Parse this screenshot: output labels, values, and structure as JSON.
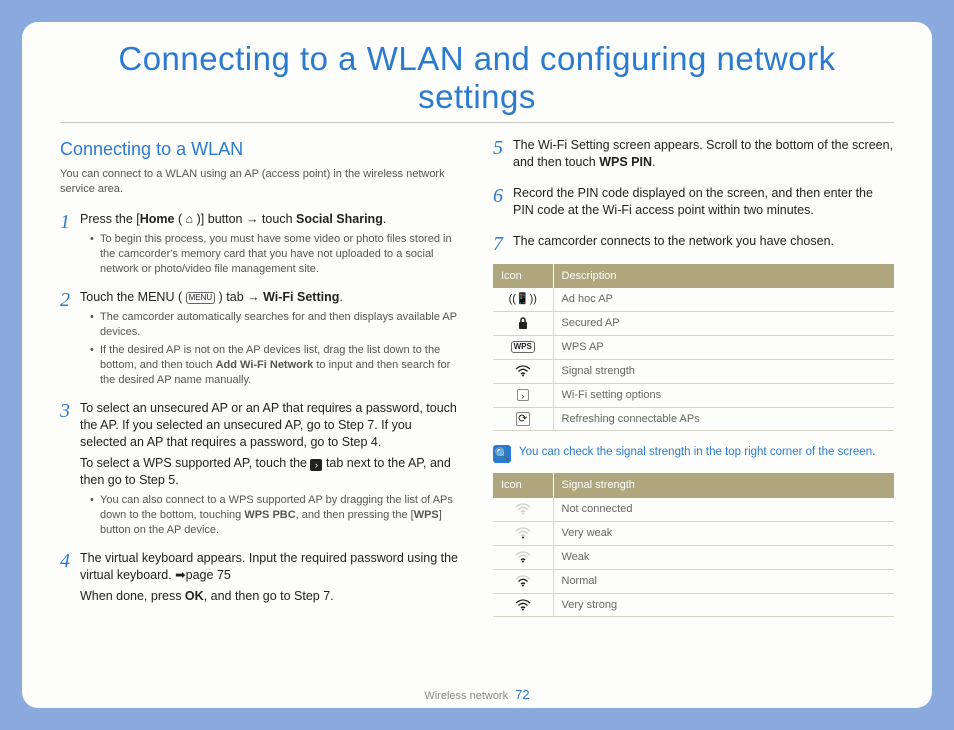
{
  "title": "Connecting to a WLAN and configuring network settings",
  "section": {
    "heading": "Connecting to a WLAN",
    "intro": "You can connect to a WLAN using an AP (access point) in the wireless network service area."
  },
  "steps": {
    "s1": {
      "pre": "Press the [",
      "home": "Home",
      "post": " )] button → touch ",
      "social": "Social Sharing",
      "end": ".",
      "b1": "To begin this process, you must have some video or photo files stored in the camcorder's memory card that you have not uploaded to a social network or photo/video file management site."
    },
    "s2": {
      "pre": "Touch the MENU ( ",
      "tab": " ) tab → ",
      "wifi": "Wi-Fi Setting",
      "end": ".",
      "b1": "The camcorder automatically searches for and then displays available AP devices.",
      "b2a": "If the desired AP is not on the AP devices list, drag the list down to the bottom, and then touch ",
      "b2b": "Add Wi-Fi Network",
      "b2c": " to input and then search for the desired AP name manually."
    },
    "s3": {
      "p1": "To select an unsecured AP or an AP that requires a password, touch the AP. If you selected an unsecured AP, go to Step 7. If you selected an AP that requires a password, go to Step 4.",
      "p2a": "To select a WPS supported AP, touch the ",
      "p2b": " tab next to the AP, and then go to Step 5.",
      "b1a": "You can also connect to a WPS supported AP by dragging the list of APs down to the bottom, touching ",
      "b1b": "WPS PBC",
      "b1c": ", and then pressing the [",
      "b1d": "WPS",
      "b1e": "] button on the AP device."
    },
    "s4": {
      "p1": "The virtual keyboard appears. Input the required password using the virtual keyboard. ➡page 75",
      "p2a": "When done, press ",
      "p2b": "OK",
      "p2c": ", and then go to Step 7."
    },
    "s5": {
      "p1a": "The Wi-Fi Setting screen appears. Scroll to the bottom of the screen, and then touch ",
      "p1b": "WPS PIN",
      "p1c": "."
    },
    "s6": {
      "p1": "Record the PIN code displayed on the screen, and then enter the PIN code at the Wi-Fi access point within two minutes."
    },
    "s7": {
      "p1": "The camcorder connects to the network you have chosen."
    }
  },
  "table1": {
    "h1": "Icon",
    "h2": "Description",
    "r1": "Ad hoc AP",
    "r2": "Secured AP",
    "r3": "WPS AP",
    "r4": "Signal strength",
    "r5": "Wi-Fi setting options",
    "r6": "Refreshing connectable APs"
  },
  "note": "You can check the signal strength in the top right corner of the screen.",
  "table2": {
    "h1": "Icon",
    "h2": "Signal strength",
    "r1": "Not connected",
    "r2": "Very weak",
    "r3": "Weak",
    "r4": "Normal",
    "r5": "Very strong"
  },
  "footer": {
    "section": "Wireless network",
    "page": "72"
  }
}
